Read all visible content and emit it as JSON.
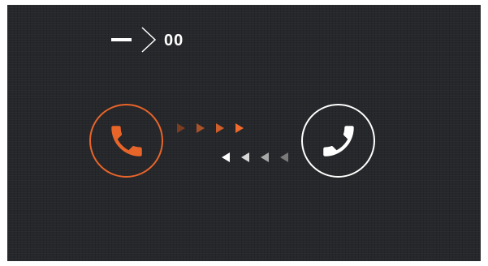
{
  "call_status": {
    "timer": "00"
  },
  "buttons": {
    "outgoing": {
      "icon": "phone-handset-icon",
      "color": "#e8652a"
    },
    "incoming": {
      "icon": "phone-handset-icon",
      "color": "#ffffff"
    }
  },
  "colors": {
    "background": "#26272a",
    "accent": "#e8652a",
    "foreground": "#ffffff"
  }
}
